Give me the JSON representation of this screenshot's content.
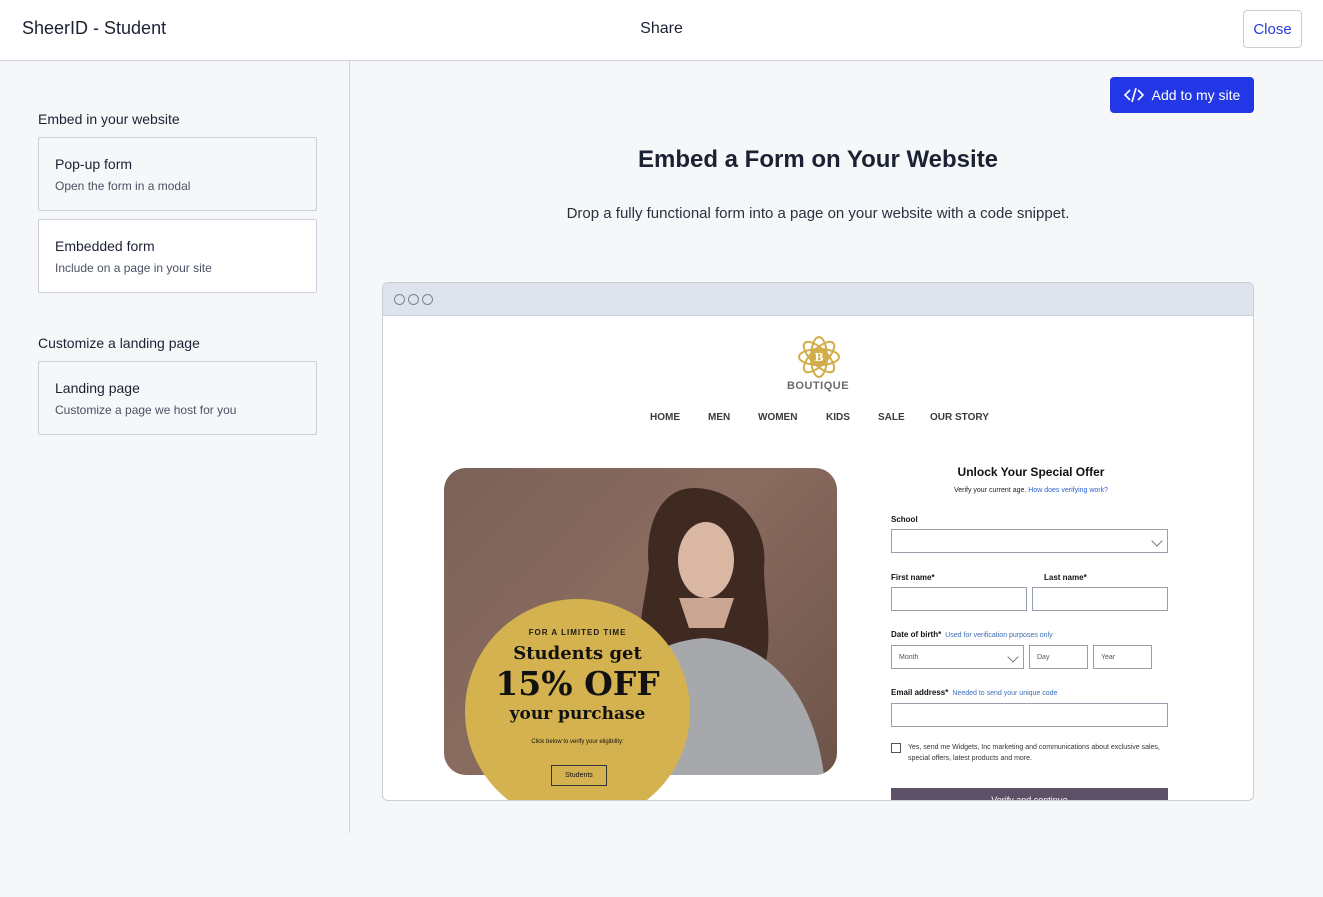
{
  "header": {
    "app_title": "SheerID - Student",
    "center_title": "Share",
    "close_label": "Close"
  },
  "sidebar": {
    "sections": [
      {
        "heading": "Embed in your website",
        "options": [
          {
            "title": "Pop-up form",
            "subtitle": "Open the form in a modal"
          },
          {
            "title": "Embedded form",
            "subtitle": "Include on a page in your site"
          }
        ]
      },
      {
        "heading": "Customize a landing page",
        "options": [
          {
            "title": "Landing page",
            "subtitle": "Customize a page we host for you"
          }
        ]
      }
    ]
  },
  "main": {
    "add_button_label": "Add to my site",
    "title": "Embed a Form on Your Website",
    "subtitle": "Drop a fully functional form into a page on your website with a code snippet."
  },
  "preview": {
    "brand": "BOUTIQUE",
    "nav": [
      "HOME",
      "MEN",
      "WOMEN",
      "KIDS",
      "SALE",
      "OUR STORY"
    ],
    "promo": {
      "kicker": "FOR A LIMITED TIME",
      "line1": "Students get",
      "line2": "15% OFF",
      "line3": "your purchase",
      "note": "Click below to verify your eligibility:",
      "button": "Students"
    },
    "form": {
      "title": "Unlock Your Special Offer",
      "subtitle": "Verify your current age.",
      "subtitle_link": "How does verifying work?",
      "school_label": "School",
      "first_name_label": "First name*",
      "last_name_label": "Last name*",
      "dob_label": "Date of birth*",
      "dob_hint": "Used for verification purposes only",
      "month_placeholder": "Month",
      "day_placeholder": "Day",
      "year_placeholder": "Year",
      "email_label": "Email address*",
      "email_hint": "Needed to send your unique code",
      "consent_text": "Yes, send me Widgets, Inc marketing and communications about exclusive sales, special offers, latest products and more.",
      "submit_label": "Verify and continue"
    }
  },
  "colors": {
    "accent": "#2337e6",
    "badge": "#d4b24f",
    "submit": "#5d5168"
  }
}
